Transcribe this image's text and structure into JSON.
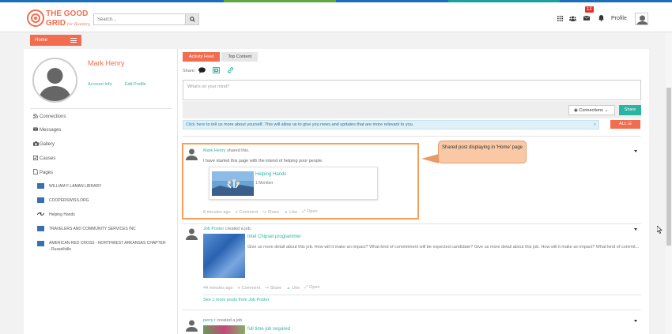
{
  "header": {
    "logo_text": "THE GOOD GRID for Reentry",
    "search_placeholder": "Search...",
    "notification_count": "12",
    "profile_label": "Profile",
    "home_label": "Home"
  },
  "profile": {
    "name": "Mark Henry",
    "account_info": "Account Info",
    "edit_profile": "Edit Profile"
  },
  "menu": [
    {
      "icon": "connections-icon",
      "label": "Connections"
    },
    {
      "icon": "messages-icon",
      "label": "Messages"
    },
    {
      "icon": "gallery-icon",
      "label": "Gallery"
    },
    {
      "icon": "causes-icon",
      "label": "Causes"
    },
    {
      "icon": "pages-icon",
      "label": "Pages"
    }
  ],
  "pages": [
    {
      "label": "WILLIAM F LAMAN LIBRARY"
    },
    {
      "label": "COOPERSWISS.ORG"
    },
    {
      "label": "Helping Hands"
    },
    {
      "label": "TRAVELERS AND COMMUNITY SERVICES INC"
    },
    {
      "label": "AMERICAN RED CROSS - NORTHWEST ARKANSAS CHAPTER - Russellville"
    }
  ],
  "tabs": {
    "activity": "Activity Feed",
    "top": "Top Content"
  },
  "composer": {
    "share_label": "Share:",
    "placeholder": "What's on your mind?",
    "connections": "Connections",
    "share_button": "Share"
  },
  "info_bar": {
    "link": "Click here",
    "text": " to tell us more about yourself. This will allow us to give you news and updates that are more relevant to you.",
    "close": "×",
    "all_button": "ALL"
  },
  "posts": [
    {
      "author": "Mark Henry",
      "verb": " shared this.",
      "body": "I have started this page with the intend of helping poor people.",
      "card_title": "Helping Hands",
      "card_meta": "1 Member",
      "time": "8 minutes ago",
      "comment": "Comment",
      "share": "Share",
      "like": "Like",
      "open": "Open"
    },
    {
      "author": "Job Poster",
      "verb": " created a job.",
      "title": "Intel Chipset programmer",
      "body": "Give us more detail about this job. How will it make an impact? What kind of commitment will be expected candidate? Give us more detail about this job. How will it make an impact? What kind of commit...",
      "time": "44 minutes ago",
      "comment": "Comment",
      "share": "Share",
      "like": "Like",
      "open": "Open",
      "see_more": "See 1 more posts from Job Poster"
    },
    {
      "author": "perry r",
      "verb": " created a job.",
      "title": "full time job required"
    }
  ],
  "annotation": {
    "callout": "Shared post displaying in 'Home' page"
  },
  "colors": {
    "accent": "#f26d4f",
    "teal": "#2bb4a1",
    "highlight": "#f5a05a",
    "callout_bg": "#f9c9a6"
  }
}
